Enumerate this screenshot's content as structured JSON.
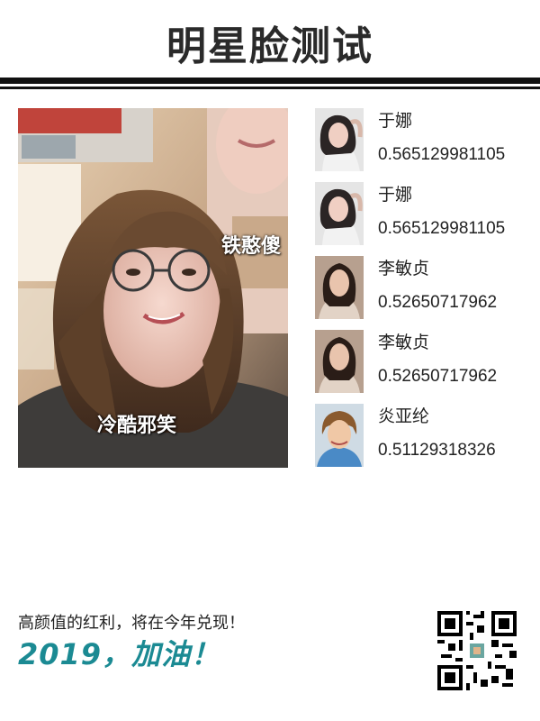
{
  "header": {
    "title": "明星脸测试"
  },
  "photo": {
    "tags": [
      "铁憨傻",
      "冷酷邪笑"
    ]
  },
  "matches": [
    {
      "name": "于娜",
      "score": "0.565129981105"
    },
    {
      "name": "于娜",
      "score": "0.565129981105"
    },
    {
      "name": "李敏贞",
      "score": "0.52650717962"
    },
    {
      "name": "李敏贞",
      "score": "0.52650717962"
    },
    {
      "name": "炎亚纶",
      "score": "0.51129318326"
    }
  ],
  "footer": {
    "tagline": "高颜值的红利，将在今年兑现！",
    "slogan": "2019，加油！"
  },
  "colors": {
    "slogan": "#1b8a93",
    "rule": "#111111",
    "title": "#2a2a2a"
  }
}
